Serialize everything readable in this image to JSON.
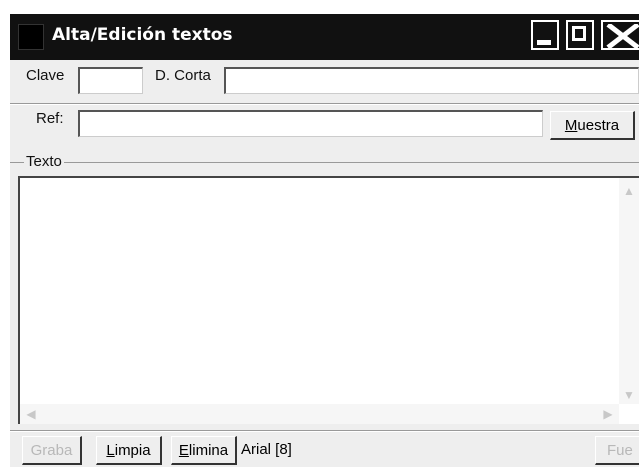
{
  "window": {
    "title": "Alta/Edición textos",
    "controls": {
      "minimize": "minimize-icon",
      "maximize": "maximize-icon",
      "close": "close-icon"
    }
  },
  "form": {
    "clave_label": "Clave",
    "clave_value": "",
    "dcorta_label": "D. Corta",
    "dcorta_value": "",
    "ref_label": "Ref:",
    "ref_value": "",
    "muestra_button": {
      "accel": "M",
      "rest": "uestra"
    }
  },
  "texto": {
    "group_label": "Texto",
    "content": ""
  },
  "footer": {
    "graba_label": "Graba",
    "limpia_button": {
      "accel": "L",
      "rest": "impia"
    },
    "elimina_button": {
      "accel": "E",
      "rest": "limina"
    },
    "font_status": "Arial [8]",
    "fuente_label": "Fue"
  }
}
